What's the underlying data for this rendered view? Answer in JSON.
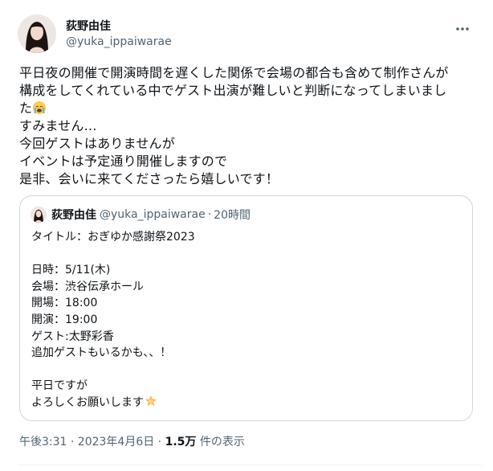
{
  "author": {
    "display_name": "荻野由佳",
    "handle": "@yuka_ippaiwarae"
  },
  "tweet": {
    "lines": [
      "平日夜の開催で開演時間を遅くした関係で会場の都合も含めて制作さんが",
      "構成をしてくれている中でゲスト出演が難しいと判断になってしまいまし",
      "た",
      "すみません…",
      "今回ゲストはありませんが",
      "イベントは予定通り開催しますので",
      "是非、会いに来てくださったら嬉しいです！"
    ],
    "emoji_icon": "crying-face-icon"
  },
  "quote": {
    "display_name": "荻野由佳",
    "handle": "@yuka_ippaiwarae",
    "separator": "·",
    "time": "20時間",
    "lines": [
      "タイトル：おぎゆか感謝祭2023",
      "",
      "日時：5/11(木)",
      "会場：渋谷伝承ホール",
      "開場：18:00",
      "開演：19:00",
      "ゲスト:太野彩香",
      "追加ゲストもいるかも、、！",
      "",
      "平日ですが",
      "よろしくお願いします"
    ],
    "emoji_icon": "glowing-star-icon"
  },
  "meta": {
    "datetime": "午後3:31 · 2023年4月6日 · ",
    "view_count": "1.5万",
    "view_label": " 件の表示"
  },
  "colors": {
    "text": "#0f1419",
    "secondary": "#536471",
    "border": "#cfd9de"
  },
  "icons": {
    "more": "more-horizontal-icon"
  }
}
